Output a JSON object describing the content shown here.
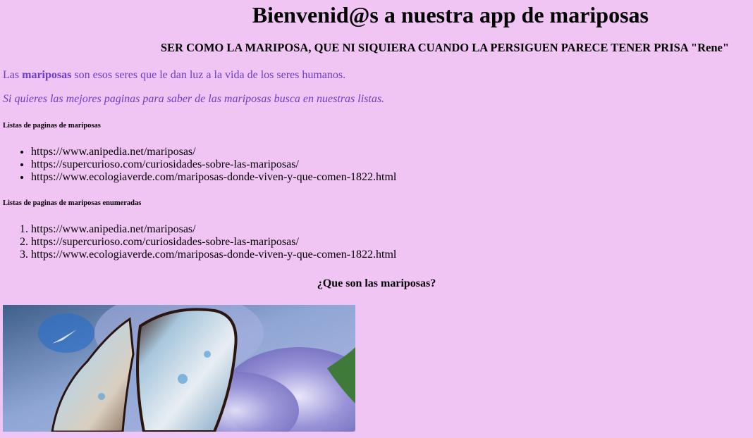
{
  "header": {
    "title": "Bienvenid@s a nuestra app de mariposas",
    "quote": "SER COMO LA MARIPOSA, QUE NI SIQUIERA CUANDO LA PERSIGUEN PARECE TENER PRISA \"Rene\""
  },
  "intro": {
    "prefix": "Las ",
    "bold": "mariposas",
    "suffix": " son esos seres que le dan luz a la vida de los seres humanos."
  },
  "cta": "Si quieres las mejores paginas para saber de las mariposas busca en nuestras listas.",
  "unordered": {
    "heading": "Listas de paginas de mariposas",
    "items": [
      "https://www.anipedia.net/mariposas/",
      "https://supercurioso.com/curiosidades-sobre-las-mariposas/",
      "https://www.ecologiaverde.com/mariposas-donde-viven-y-que-comen-1822.html"
    ]
  },
  "ordered": {
    "heading": "Listas de paginas de mariposas enumeradas",
    "items": [
      "https://www.anipedia.net/mariposas/",
      "https://supercurioso.com/curiosidades-sobre-las-mariposas/",
      "https://www.ecologiaverde.com/mariposas-donde-viven-y-que-comen-1822.html"
    ]
  },
  "section": {
    "heading": "¿Que son las mariposas?"
  },
  "colors": {
    "background": "#f0c4f3",
    "accent_text": "#6a3fc8"
  }
}
